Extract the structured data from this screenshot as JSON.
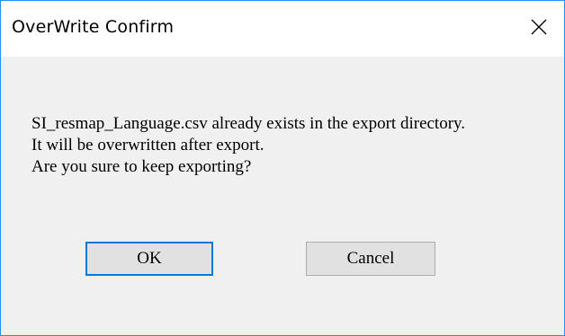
{
  "window": {
    "title": "OverWrite Confirm",
    "close_icon": "close-icon"
  },
  "message": {
    "line1": "SI_resmap_Language.csv already exists in the export directory.",
    "line2": "It will be overwritten after export.",
    "line3": "Are you sure to keep exporting?"
  },
  "buttons": {
    "ok_label": "OK",
    "cancel_label": "Cancel"
  },
  "colors": {
    "window_border": "#1e90ff",
    "dialog_background": "#f0f0f0",
    "titlebar_background": "#ffffff",
    "default_button_border": "#0078d7",
    "button_background": "#e1e1e1"
  }
}
